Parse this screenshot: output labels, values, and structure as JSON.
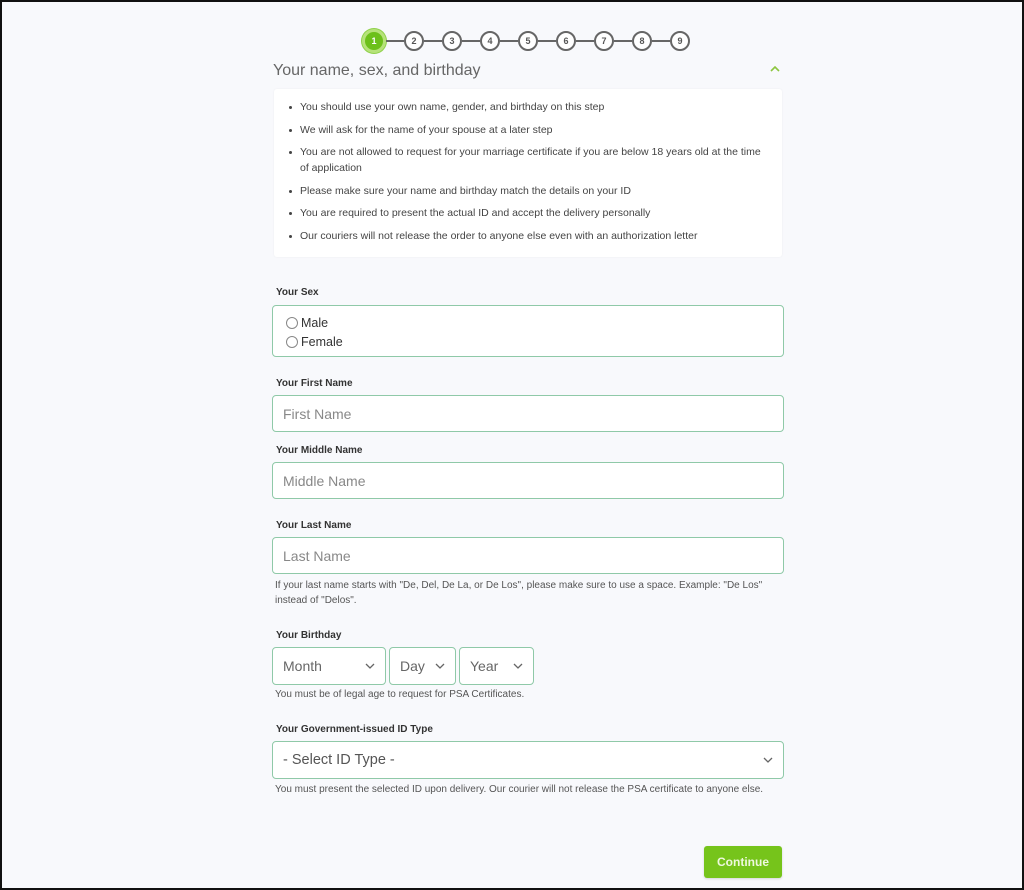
{
  "stepper": {
    "steps": [
      "1",
      "2",
      "3",
      "4",
      "5",
      "6",
      "7",
      "8",
      "9"
    ],
    "current": 1,
    "active_color": "#6cc01a"
  },
  "section": {
    "title": "Your name, sex, and birthday",
    "collapse_icon": "chevron-up-icon",
    "notes": [
      "You should use your own name, gender, and birthday on this step",
      "We will ask for the name of your spouse at a later step",
      "You are not allowed to request for your marriage certificate if you are below 18 years old at the time of application",
      "Please make sure your name and birthday match the details on your ID",
      "You are required to present the actual ID and accept the delivery personally",
      "Our couriers will not release the order to anyone else even with an authorization letter"
    ]
  },
  "form": {
    "sex": {
      "label": "Your Sex",
      "options": [
        "Male",
        "Female"
      ],
      "selected": null
    },
    "first_name": {
      "label": "Your First Name",
      "placeholder": "First Name",
      "value": ""
    },
    "middle_name": {
      "label": "Your Middle Name",
      "placeholder": "Middle Name",
      "value": ""
    },
    "last_name": {
      "label": "Your Last Name",
      "placeholder": "Last Name",
      "value": "",
      "help": "If your last name starts with \"De, Del, De La, or De Los\", please make sure to use a space. Example: \"De Los\" instead of \"Delos\"."
    },
    "birthday": {
      "label": "Your Birthday",
      "month": "Month",
      "day": "Day",
      "year": "Year",
      "help": "You must be of legal age to request for PSA Certificates."
    },
    "id_type": {
      "label": "Your Government-issued ID Type",
      "selected": "- Select ID Type -",
      "help": "You must present the selected ID upon delivery. Our courier will not release the PSA certificate to anyone else."
    }
  },
  "actions": {
    "continue_label": "Continue",
    "continue_color": "#76c41b"
  }
}
